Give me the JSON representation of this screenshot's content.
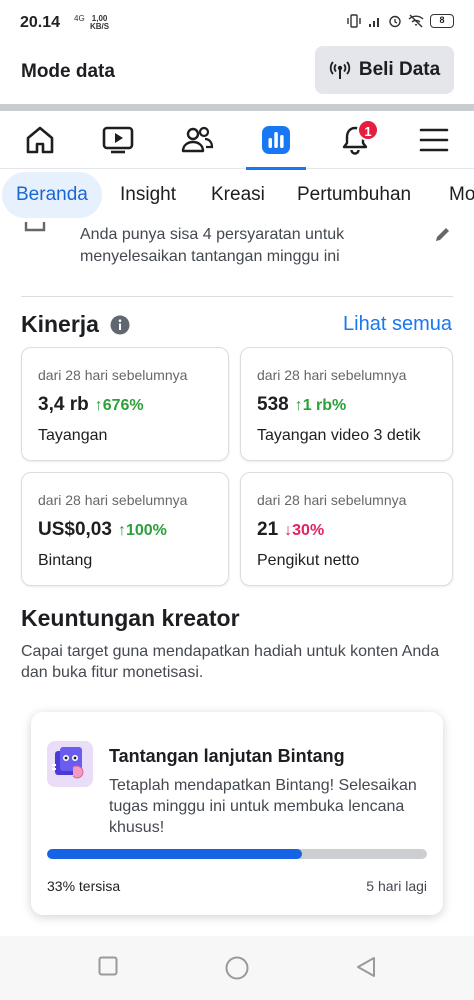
{
  "status_bar": {
    "time": "20.14",
    "network": "4G",
    "speed_value": "1,00",
    "speed_unit": "KB/S",
    "battery": "8"
  },
  "data_mode": {
    "label": "Mode data",
    "buy_button": "Beli Data"
  },
  "nav": {
    "notification_count": "1",
    "icons": [
      "home-icon",
      "video-icon",
      "friends-icon",
      "dashboard-icon",
      "bell-icon",
      "menu-icon"
    ],
    "active": "dashboard-icon",
    "accent": "#1877f2"
  },
  "tabs": [
    {
      "label": "Beranda",
      "active": true
    },
    {
      "label": "Insight",
      "active": false
    },
    {
      "label": "Kreasi",
      "active": false
    },
    {
      "label": "Pertumbuhan",
      "active": false
    },
    {
      "label": "Mo",
      "active": false
    }
  ],
  "requirements": {
    "text": "Anda punya sisa 4 persyaratan untuk menyelesaikan tantangan minggu ini"
  },
  "performance": {
    "title": "Kinerja",
    "see_all": "Lihat semua",
    "cards": [
      {
        "subtitle": "dari 28 hari sebelumnya",
        "value": "3,4 rb",
        "delta": "↑676%",
        "trend": "up",
        "label": "Tayangan"
      },
      {
        "subtitle": "dari 28 hari sebelumnya",
        "value": "538",
        "delta": "↑1 rb%",
        "trend": "up",
        "label": "Tayangan video 3 detik"
      },
      {
        "subtitle": "dari 28 hari sebelumnya",
        "value": "US$0,03",
        "delta": "↑100%",
        "trend": "up",
        "label": "Bintang"
      },
      {
        "subtitle": "dari 28 hari sebelumnya",
        "value": "21",
        "delta": "↓30%",
        "trend": "down",
        "label": "Pengikut netto"
      }
    ],
    "up_color": "#2ba13b",
    "down_color": "#e0245e"
  },
  "creator_benefits": {
    "title": "Keuntungan kreator",
    "description": "Capai target guna mendapatkan hadiah untuk konten Anda dan buka fitur monetisasi."
  },
  "challenge": {
    "title": "Tantangan lanjutan Bintang",
    "description": "Tetaplah mendapatkan Bintang! Selesaikan tugas minggu ini untuk membuka lencana khusus!",
    "progress_fraction": 0.67,
    "remaining": "33% tersisa",
    "days_left": "5 hari lagi",
    "progress_color": "#1763e6"
  }
}
